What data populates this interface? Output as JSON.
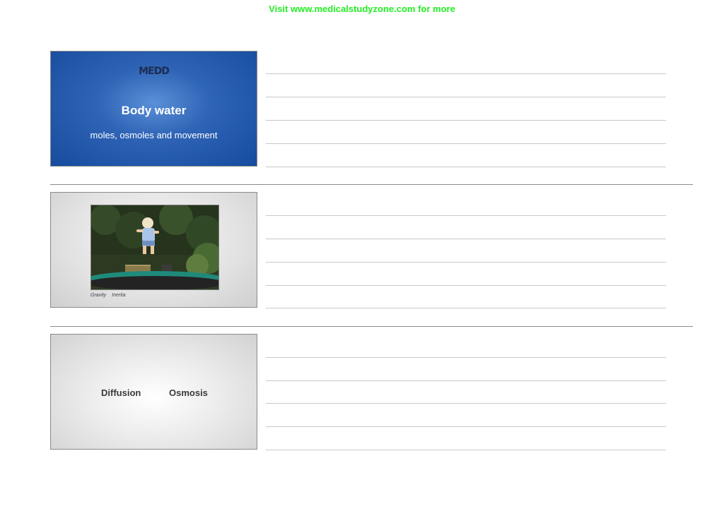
{
  "banner": {
    "text": "Visit www.medicalstudyzone.com for more"
  },
  "slides": [
    {
      "logo": "MEDD",
      "title": "Body water",
      "subtitle": "moles, osmoles and movement"
    },
    {
      "caption_words": [
        "Gravity",
        "Inertia"
      ]
    },
    {
      "labels": [
        "Diffusion",
        "Osmosis"
      ]
    }
  ],
  "colors": {
    "banner": "#22ee22",
    "slide1_background": "#2e63b5",
    "note_lines": "#c8c8c8"
  }
}
